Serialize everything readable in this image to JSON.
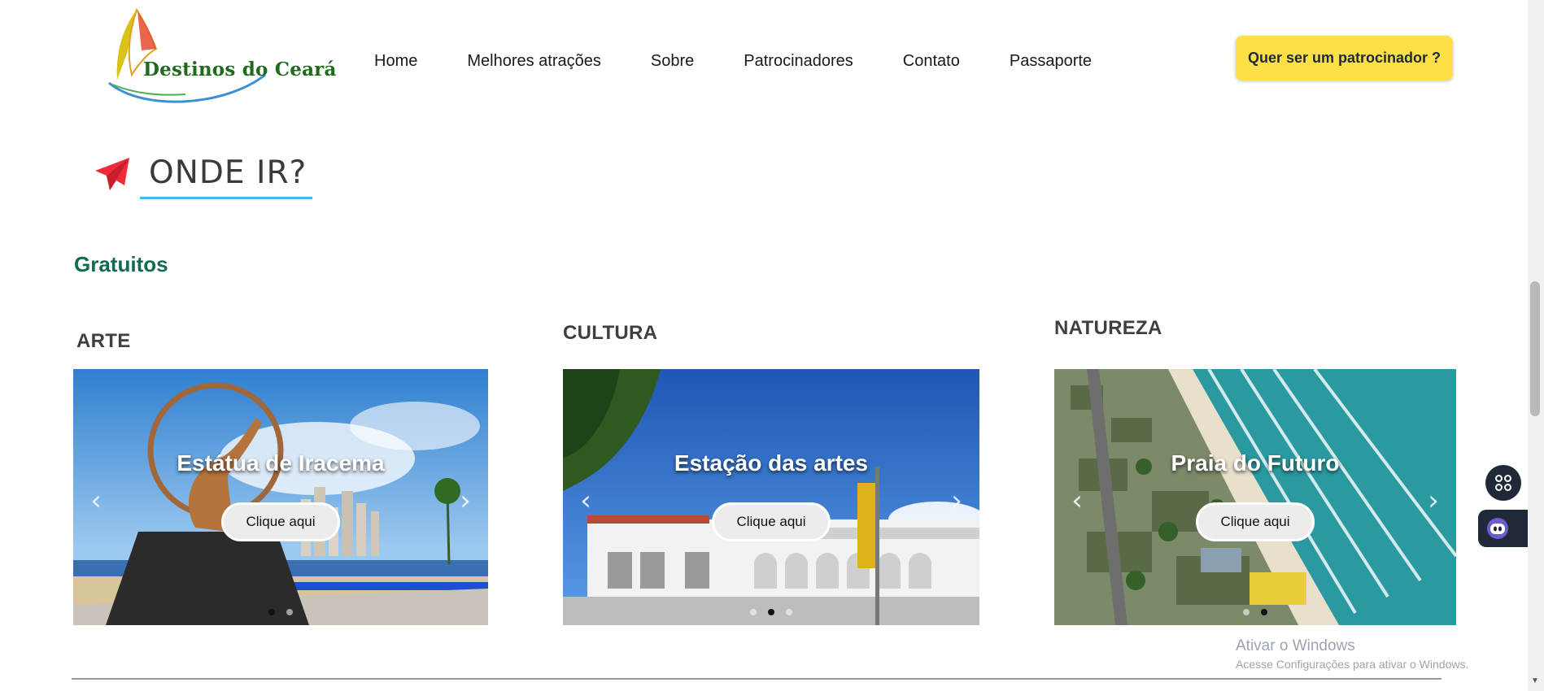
{
  "header": {
    "logo_text": "Destinos do Ceará",
    "nav": [
      "Home",
      "Melhores atrações",
      "Sobre",
      "Patrocinadores",
      "Contato",
      "Passaporte"
    ],
    "cta_label": "Quer ser um patrocinador ?"
  },
  "section": {
    "title": "ONDE IR?",
    "icon": "paper-plane-icon",
    "subheading": "Gratuitos"
  },
  "categories": [
    {
      "label": "ARTE",
      "card_title": "Estátua de Iracema",
      "button": "Clique aqui",
      "active_dot": 1,
      "dot_count": 2
    },
    {
      "label": "CULTURA",
      "card_title": "Estação das artes",
      "button": "Clique aqui",
      "active_dot": 2,
      "dot_count": 3
    },
    {
      "label": "NATUREZA",
      "card_title": "Praia do Futuro",
      "button": "Clique aqui",
      "active_dot": 2,
      "dot_count": 2
    }
  ],
  "windows_watermark": {
    "title": "Ativar o Windows",
    "subtitle": "Acesse Configurações para ativar o Windows."
  },
  "colors": {
    "cta_bg": "#fde047",
    "title_underline": "#38bdf8",
    "subheading": "#0f6b52",
    "plane": "#ef2b3a"
  }
}
